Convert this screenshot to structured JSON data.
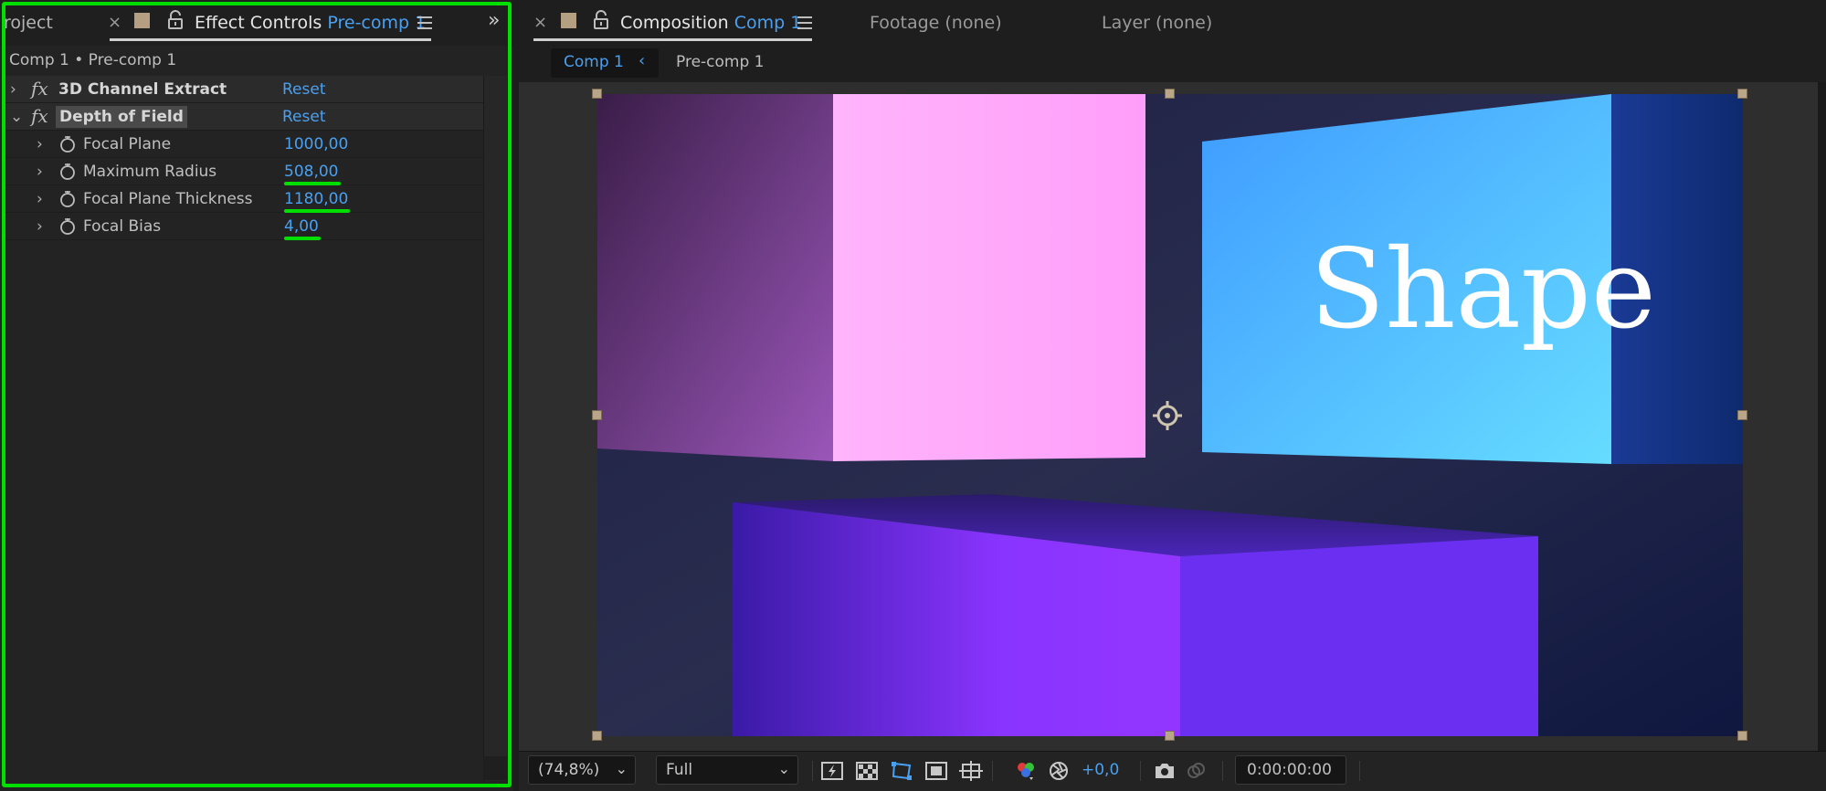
{
  "left_panel": {
    "project_tab": "roject",
    "effect_controls_tab": {
      "label": "Effect Controls",
      "layer": "Pre-comp 1"
    },
    "header": "Comp 1 • Pre-comp 1",
    "effects": [
      {
        "name": "3D Channel Extract",
        "reset": "Reset"
      },
      {
        "name": "Depth of Field",
        "reset": "Reset"
      }
    ],
    "properties": [
      {
        "name": "Focal Plane",
        "value": "1000,00"
      },
      {
        "name": "Maximum Radius",
        "value": "508,00"
      },
      {
        "name": "Focal Plane Thickness",
        "value": "1180,00"
      },
      {
        "name": "Focal Bias",
        "value": "4,00"
      }
    ]
  },
  "right_panel": {
    "composition_tab": {
      "label": "Composition",
      "comp": "Comp 1"
    },
    "footage_tab": "Footage (none)",
    "layer_tab": "Layer (none)",
    "breadcrumbs": [
      "Comp 1",
      "Pre-comp 1"
    ],
    "canvas_text": "Shape",
    "toolbar": {
      "zoom": "(74,8%)",
      "resolution": "Full",
      "exposure": "+0,0",
      "timecode": "0:00:00:00"
    }
  },
  "icons": {
    "close": "close-icon",
    "label_color": "label-color-swatch",
    "lock": "lock-icon",
    "menu": "hamburger-menu-icon",
    "expand": "double-chevron-icon",
    "stopwatch": "stopwatch-icon",
    "fx": "fx-icon"
  },
  "colors": {
    "accent": "#4aa0f0",
    "highlight": "#00e000",
    "label_swatch": "#b49f82"
  }
}
